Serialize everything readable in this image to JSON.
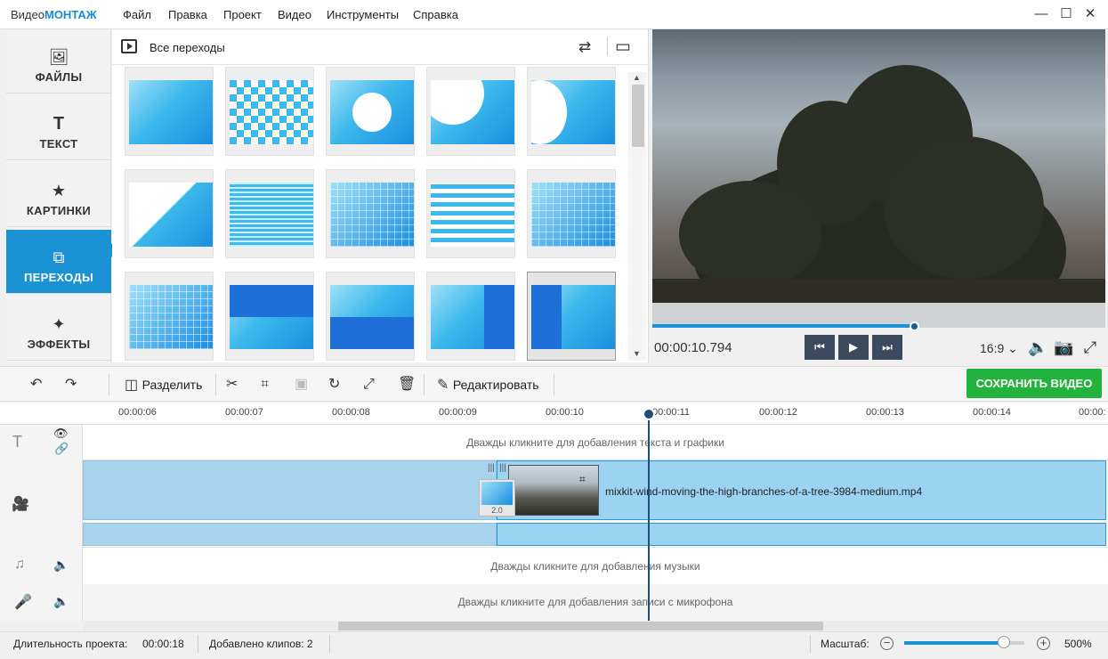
{
  "app": {
    "brand_a": "Видео",
    "brand_b": "МОНТАЖ"
  },
  "menu": [
    "Файл",
    "Правка",
    "Проект",
    "Видео",
    "Инструменты",
    "Справка"
  ],
  "window": {
    "minimize": "—",
    "maximize": "☐",
    "close": "✕"
  },
  "nav": [
    {
      "label": "ФАЙЛЫ",
      "icon": "🖼"
    },
    {
      "label": "ТЕКСТ",
      "icon": "T"
    },
    {
      "label": "КАРТИНКИ",
      "icon": "★"
    },
    {
      "label": "ПЕРЕХОДЫ",
      "icon": "⧉"
    },
    {
      "label": "ЭФФЕКТЫ",
      "icon": "✦"
    }
  ],
  "panel": {
    "title": "Все переходы",
    "shuffle_icon": "⇄",
    "view_icon": "▭"
  },
  "transitions_count": 15,
  "preview": {
    "timecode": "00:00:10.794",
    "progress": 0.58,
    "ratio": "16:9 ⌄"
  },
  "player": {
    "prev": "⏮",
    "play": "▶",
    "next": "⏭"
  },
  "toolbar": {
    "undo": "↶",
    "redo": "↷",
    "split_icon": "◫",
    "split": "Разделить",
    "cut": "✂",
    "crop": "⌗",
    "rotate": "↻",
    "resize": "⤢",
    "delete": "🗑",
    "edit_icon": "✎",
    "edit": "Редактировать",
    "save": "СОХРАНИТЬ ВИДЕО"
  },
  "ruler": [
    "00:00:06",
    "00:00:07",
    "00:00:08",
    "00:00:09",
    "00:00:10",
    "00:00:11",
    "00:00:12",
    "00:00:13",
    "00:00:14",
    "00:00:"
  ],
  "tracks": {
    "text_hint": "Дважды кликните для добавления текста и графики",
    "music_hint": "Дважды кликните для добавления музыки",
    "mic_hint": "Дважды кликните для добавления записи с микрофона",
    "clip_name": "mixkit-wind-moving-the-high-branches-of-a-tree-3984-medium.mp4",
    "transition_duration": "2.0"
  },
  "status": {
    "duration_label": "Длительность проекта:",
    "duration": "00:00:18",
    "clips": "Добавлено клипов: 2",
    "zoom_label": "Масштаб:",
    "zoom": "500%",
    "zoom_level": 0.83
  }
}
